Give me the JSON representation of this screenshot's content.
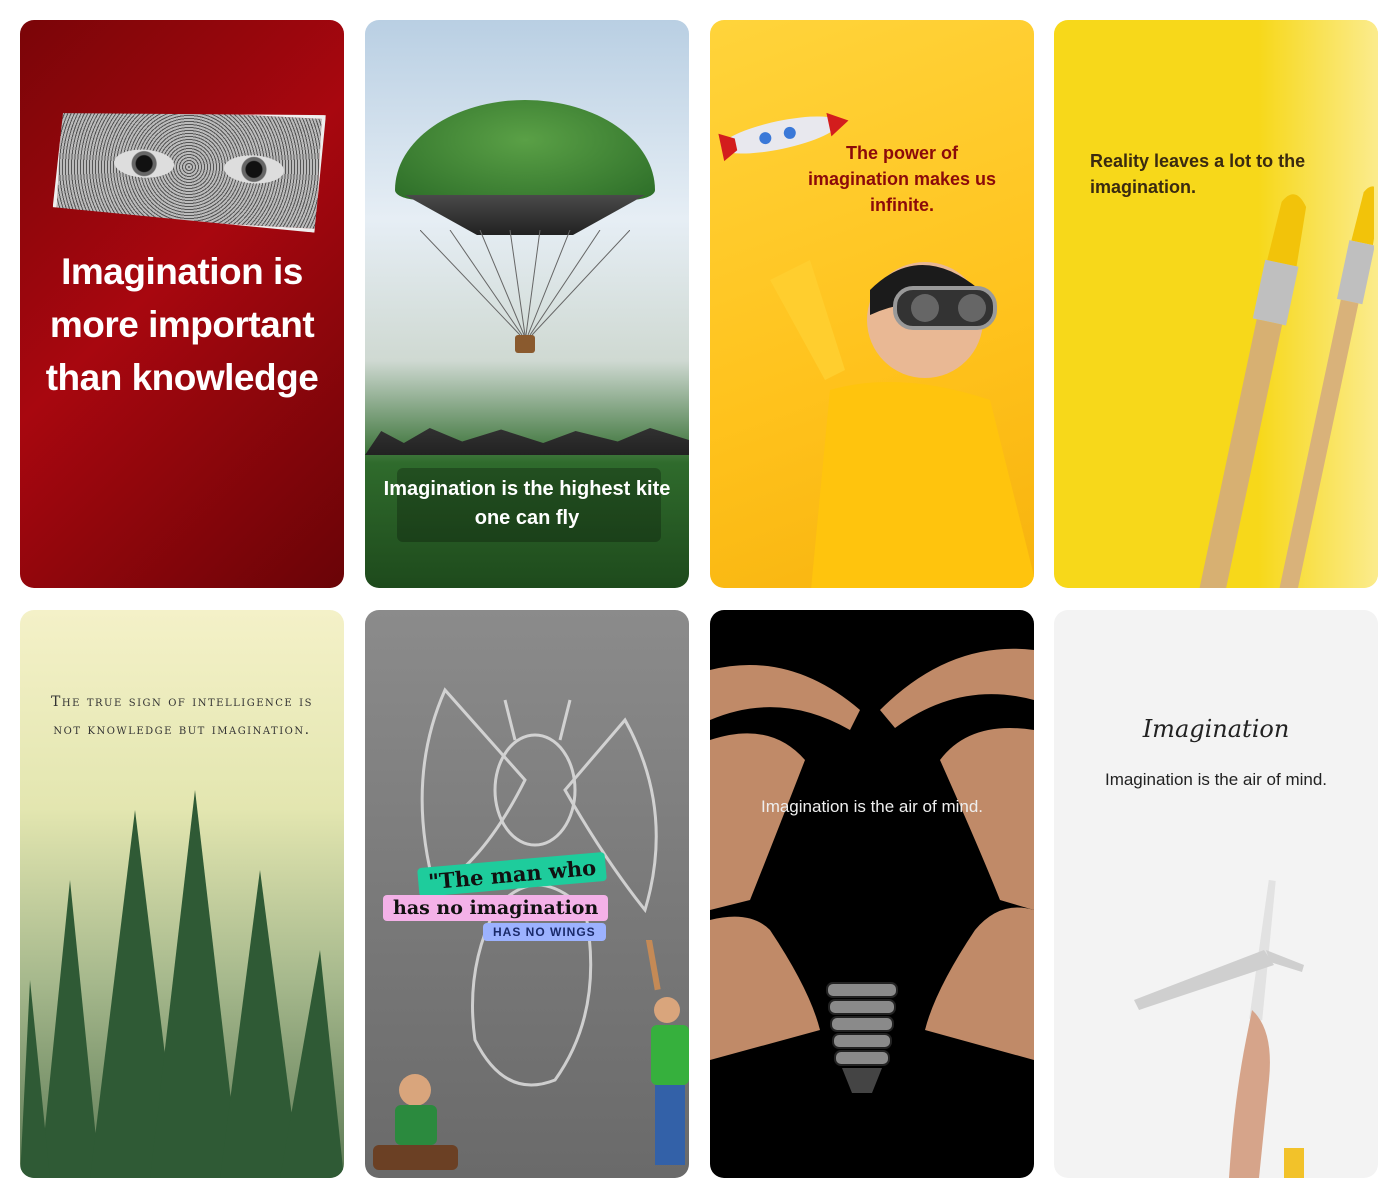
{
  "cards": {
    "c1": {
      "quote": "Imagination is more important than knowledge"
    },
    "c2": {
      "quote": "Imagination is the highest kite one can fly"
    },
    "c3": {
      "quote": "The power of imagination makes us infinite."
    },
    "c4": {
      "quote": "Reality leaves a lot to the imagination."
    },
    "c5": {
      "quote": "The true sign of intelligence is not knowledge but imagination."
    },
    "c6": {
      "tag1": "\"The man who",
      "tag2": "has no imagination",
      "tag3": "HAS NO WINGS"
    },
    "c7": {
      "quote": "Imagination is the air of mind."
    },
    "c8": {
      "script_title": "Imagination",
      "quote": "Imagination is the air of mind."
    }
  }
}
